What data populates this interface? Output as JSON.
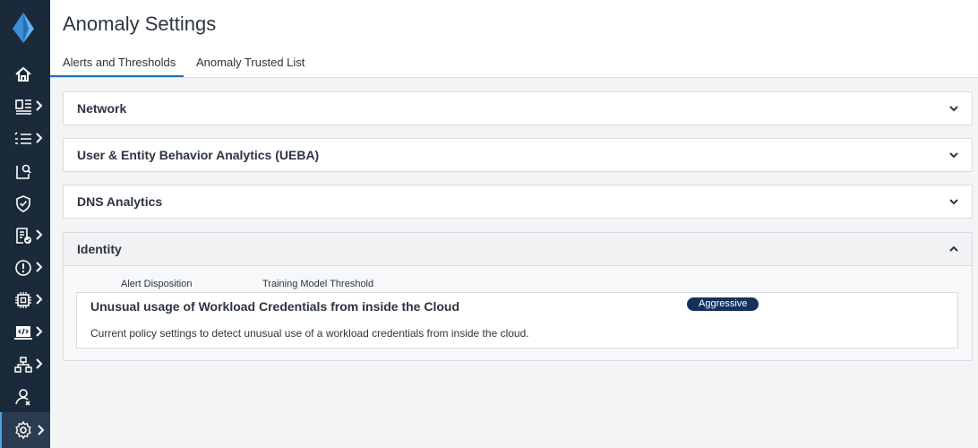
{
  "page": {
    "title": "Anomaly Settings"
  },
  "tabs": [
    {
      "label": "Alerts and Thresholds",
      "active": true
    },
    {
      "label": "Anomaly Trusted List",
      "active": false
    }
  ],
  "sidebar": {
    "items": [
      {
        "icon": "home-icon",
        "has_submenu": false
      },
      {
        "icon": "dashboard-icon",
        "has_submenu": true
      },
      {
        "icon": "list-icon",
        "has_submenu": true
      },
      {
        "icon": "investigate-icon",
        "has_submenu": false
      },
      {
        "icon": "shield-check-icon",
        "has_submenu": false
      },
      {
        "icon": "compliance-icon",
        "has_submenu": true
      },
      {
        "icon": "alert-icon",
        "has_submenu": true
      },
      {
        "icon": "chip-icon",
        "has_submenu": true
      },
      {
        "icon": "code-icon",
        "has_submenu": true
      },
      {
        "icon": "network-icon",
        "has_submenu": true
      },
      {
        "icon": "identity-icon",
        "has_submenu": false
      },
      {
        "icon": "settings-icon",
        "has_submenu": true,
        "active": true
      }
    ]
  },
  "panels": {
    "network": {
      "title": "Network",
      "expanded": false
    },
    "ueba": {
      "title": "User & Entity Behavior Analytics (UEBA)",
      "expanded": false
    },
    "dns": {
      "title": "DNS Analytics",
      "expanded": false
    },
    "identity": {
      "title": "Identity",
      "expanded": true,
      "columns": [
        "Alert Disposition",
        "Training Model Threshold"
      ],
      "policy": {
        "title": "Unusual usage of Workload Credentials from inside the Cloud",
        "description": "Current policy settings to detect unusual use of a workload credentials from inside the cloud.",
        "badge": "Aggressive"
      }
    }
  },
  "colors": {
    "sidebar": "#1b2a3a",
    "accent": "#1f6fb8",
    "badge": "#14325c"
  }
}
